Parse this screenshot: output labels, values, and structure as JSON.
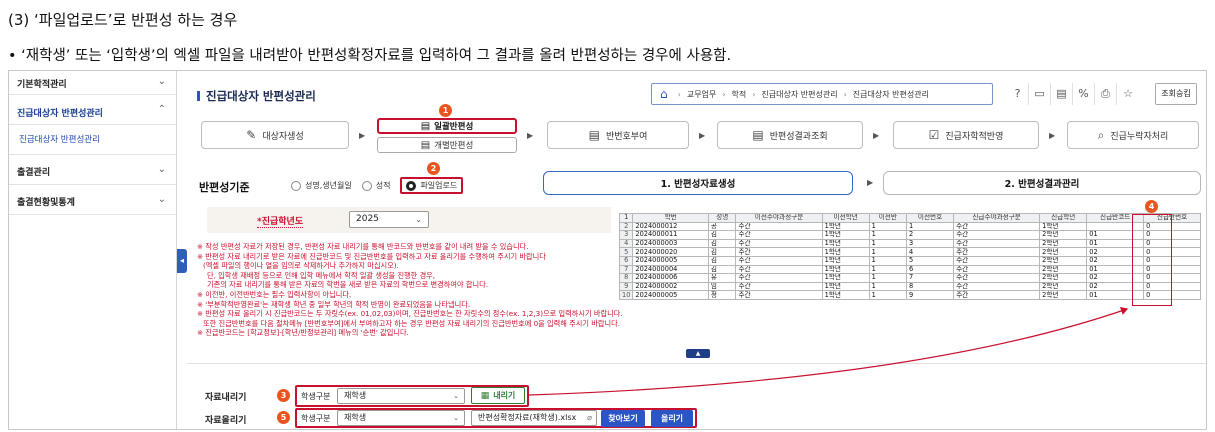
{
  "doc": {
    "heading": "(3) ‘파일업로드’로 반편성 하는 경우",
    "description": "• ‘재학생’ 또는 ‘입학생’의 엑셀 파일을 내려받아 반편성확정자료를 입력하여 그 결과를 올려 반편성하는 경우에 사용함."
  },
  "sidebar": {
    "items": [
      {
        "label": "기본학적관리"
      },
      {
        "label": "진급대상자 반편성관리"
      },
      {
        "label": "진급대상자 반편성관리"
      },
      {
        "label": "출결관리"
      },
      {
        "label": "출결현황및통계"
      }
    ]
  },
  "header": {
    "title": "진급대상자 반편성관리",
    "breadcrumb": [
      "교무업무",
      "학적",
      "진급대상자 반편성관리",
      "진급대상자 반편성관리"
    ],
    "query_button": "조회승킴"
  },
  "steps": {
    "items": [
      {
        "label": "대상자생성"
      },
      {
        "label": "일괄반편성"
      },
      {
        "label": "개별반편성"
      },
      {
        "label": "반번호부여"
      },
      {
        "label": "반편성결과조회"
      },
      {
        "label": "진급자학적반영"
      },
      {
        "label": "진급누락자처리"
      }
    ]
  },
  "badges": [
    "1",
    "2",
    "3",
    "4",
    "5"
  ],
  "criteria": {
    "label": "반편성기준",
    "options": [
      "성명,생년월일",
      "성적",
      "파일업로드"
    ],
    "selected": "파일업로드"
  },
  "phases": [
    "1. 반편성자료생성",
    "2. 반편성결과관리"
  ],
  "year": {
    "label": "*진급학년도",
    "value": "2025"
  },
  "notes": [
    "※ 작성 반편성 자료가 저장된 경우, 반편성 자료 내리기를 통해 반코드와 반번호를 같이 내려 받을 수 있습니다.",
    "※ 반편성 자료 내리기로 받은 자료에 진급반코드 및 진급반번호를 입력하고 자료 올리기를 수행하여 주시기 바랍니다",
    "(엑셀 파일의 행이나 열을 임의로 삭제하거나 추가하지 마십시오).",
    "단, 입학생 재배정 등으로 인해 입학 메뉴에서 학적 일괄 생성을 진행한 경우,",
    "기존의 자료 내리기를 통해 받은 자료의 학번을 새로 받은 자료의 학번으로 변경하여야 합니다.",
    "※ 이전반, 이전반번호는 필수 입력사항이 아닙니다.",
    "※ '부분학적반영완료'는 재학생 학년 중 일부 학년의 학적 반영이 완료되었음을 나타냅니다.",
    "※ 반편성 자료 올리기 시 진급반코드는 두 자릿수(ex. 01,02,03)이며, 진급반번호는 한 자릿수의 정수(ex. 1,2,3)으로 입력하시기 바랍니다.",
    "또한 진급반번호를 다음 절차메뉴 [반번호부여]에서 부여하고자 하는 경우 반편성 자료 내리기의 진급반번호에 0을 입력해 주시기 바랍니다.",
    "※ 진급반코드는 [학교정보]-[학년/반정보관리] 메뉴의 '순번' 값입니다."
  ],
  "excel": {
    "headers": [
      "학번",
      "성명",
      "이전주야과정구분",
      "이전학년",
      "이전반",
      "이전번호",
      "진급주야과정구분",
      "진급학년",
      "진급반코드",
      "진급반번호"
    ],
    "rows": [
      [
        "2",
        "2024000012",
        "공",
        "주간",
        "1학년",
        "1",
        "1",
        "주간",
        "1학년",
        "",
        "0"
      ],
      [
        "3",
        "2024000011",
        "김",
        "주간",
        "1학년",
        "1",
        "2",
        "주간",
        "2학년",
        "01",
        "0"
      ],
      [
        "4",
        "2024000003",
        "김",
        "주간",
        "1학년",
        "1",
        "3",
        "주간",
        "2학년",
        "01",
        "0"
      ],
      [
        "5",
        "2024000020",
        "김",
        "주간",
        "1학년",
        "1",
        "4",
        "주간",
        "2학년",
        "02",
        "0"
      ],
      [
        "6",
        "2024000005",
        "김",
        "주간",
        "1학년",
        "1",
        "5",
        "주간",
        "2학년",
        "02",
        "0"
      ],
      [
        "7",
        "2024000004",
        "김",
        "주간",
        "1학년",
        "1",
        "6",
        "주간",
        "2학년",
        "01",
        "0"
      ],
      [
        "8",
        "2024000006",
        "유",
        "주간",
        "1학년",
        "1",
        "7",
        "주간",
        "2학년",
        "02",
        "0"
      ],
      [
        "9",
        "2024000002",
        "임",
        "주간",
        "1학년",
        "1",
        "8",
        "주간",
        "2학년",
        "02",
        "0"
      ],
      [
        "10",
        "2024000005",
        "정",
        "주간",
        "1학년",
        "1",
        "9",
        "주간",
        "2학년",
        "01",
        "0"
      ]
    ]
  },
  "download": {
    "row_label": "자료내리기",
    "type_label": "학생구분",
    "type_value": "재학생",
    "button": "내리기"
  },
  "upload": {
    "row_label": "자료올리기",
    "type_label": "학생구분",
    "type_value": "재학생",
    "file_name": "반편성확정자료(재학생).xlsx",
    "browse_button": "찾아보기",
    "upload_button": "올리기"
  },
  "colors": {
    "accent_red": "#c8102e",
    "badge_orange": "#e8551f",
    "primary_blue": "#2b55c7"
  }
}
